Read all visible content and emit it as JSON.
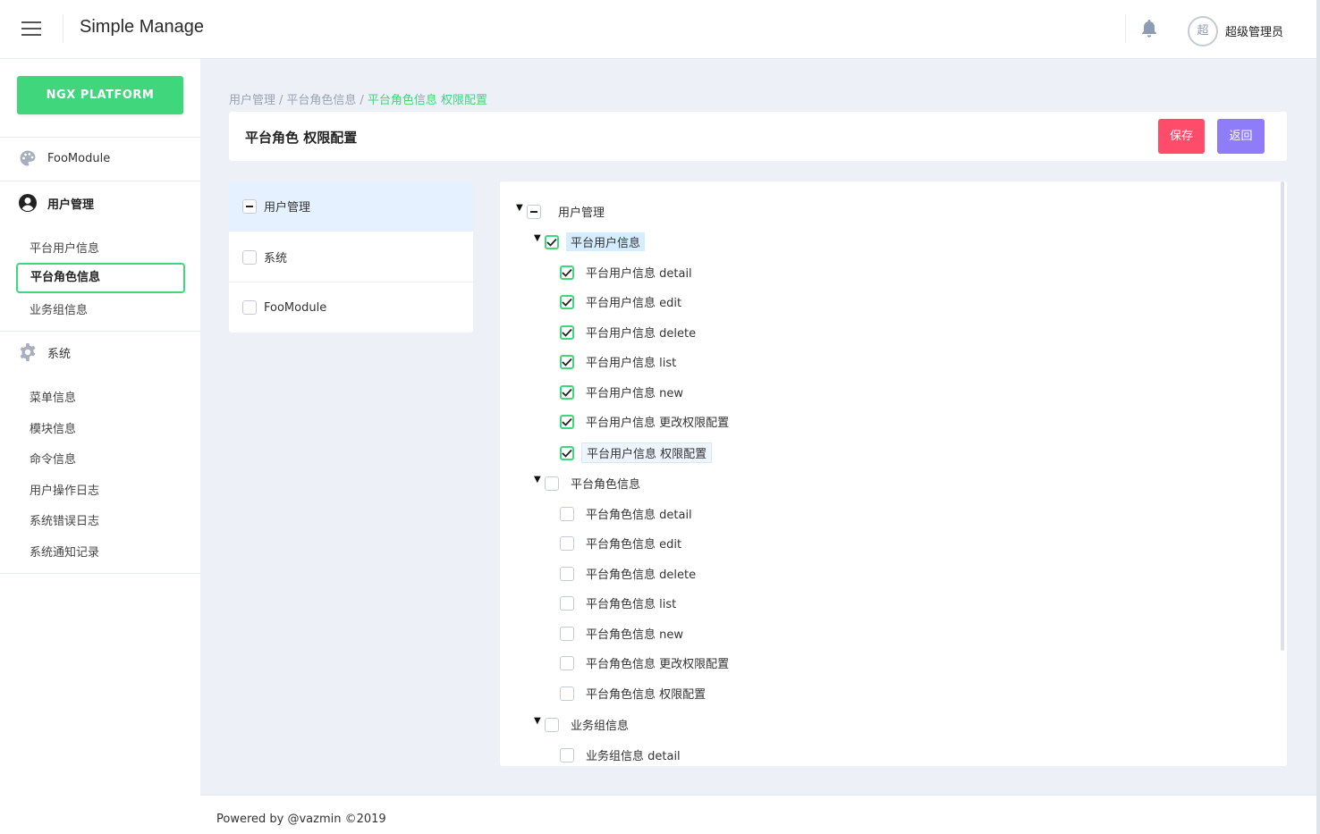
{
  "header": {
    "app_title": "Simple Manage",
    "avatar_initial": "超",
    "username": "超级管理员",
    "menu_icon": "hamburger-icon",
    "notification_icon": "bell-icon"
  },
  "sidebar": {
    "platform_button": "NGX PLATFORM",
    "groups": [
      {
        "label": "FooModule",
        "icon": "palette-icon"
      },
      {
        "label": "用户管理",
        "icon": "user-circle-icon"
      },
      {
        "label": "系统",
        "icon": "gear-icon"
      }
    ],
    "user_items": [
      "平台用户信息",
      "平台角色信息",
      "业务组信息"
    ],
    "system_items": [
      "菜单信息",
      "模块信息",
      "命令信息",
      "用户操作日志",
      "系统错误日志",
      "系统通知记录"
    ],
    "active_item": "平台角色信息"
  },
  "breadcrumb": {
    "items": [
      "用户管理",
      "平台角色信息"
    ],
    "current": "平台角色信息 权限配置",
    "separator": "/"
  },
  "page": {
    "title": "平台角色 权限配置",
    "save_label": "保存",
    "back_label": "返回"
  },
  "modules": [
    {
      "label": "用户管理",
      "state": "indeterminate",
      "selected": true
    },
    {
      "label": "系统",
      "state": "unchecked",
      "selected": false
    },
    {
      "label": "FooModule",
      "state": "unchecked",
      "selected": false
    }
  ],
  "tree": {
    "root": {
      "label": "用户管理",
      "state": "indeterminate"
    },
    "groups": [
      {
        "label": "平台用户信息",
        "state": "checked",
        "highlighted": true,
        "children": [
          {
            "label": "平台用户信息 detail",
            "state": "checked"
          },
          {
            "label": "平台用户信息 edit",
            "state": "checked"
          },
          {
            "label": "平台用户信息 delete",
            "state": "checked"
          },
          {
            "label": "平台用户信息 list",
            "state": "checked"
          },
          {
            "label": "平台用户信息 new",
            "state": "checked"
          },
          {
            "label": "平台用户信息 更改权限配置",
            "state": "checked"
          },
          {
            "label": "平台用户信息 权限配置",
            "state": "checked",
            "highlighted": true
          }
        ]
      },
      {
        "label": "平台角色信息",
        "state": "unchecked",
        "children": [
          {
            "label": "平台角色信息 detail",
            "state": "unchecked"
          },
          {
            "label": "平台角色信息 edit",
            "state": "unchecked"
          },
          {
            "label": "平台角色信息 delete",
            "state": "unchecked"
          },
          {
            "label": "平台角色信息 list",
            "state": "unchecked"
          },
          {
            "label": "平台角色信息 new",
            "state": "unchecked"
          },
          {
            "label": "平台角色信息 更改权限配置",
            "state": "unchecked"
          },
          {
            "label": "平台角色信息 权限配置",
            "state": "unchecked"
          }
        ]
      },
      {
        "label": "业务组信息",
        "state": "unchecked",
        "children": [
          {
            "label": "业务组信息 detail",
            "state": "unchecked"
          }
        ]
      }
    ]
  },
  "footer": {
    "text": "Powered by @vazmin ©2019"
  },
  "colors": {
    "primary": "#3fd67c",
    "danger": "#ff4c6a",
    "info": "#8f7cf8",
    "background": "#edf1f7"
  }
}
